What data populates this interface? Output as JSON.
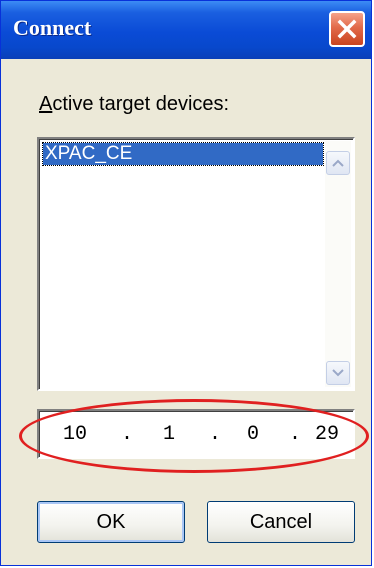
{
  "window": {
    "title": "Connect"
  },
  "devices": {
    "label_access_key": "A",
    "label_rest": "ctive target devices:",
    "items": [
      "XPAC_CE"
    ],
    "selected_index": 0
  },
  "ip_address": {
    "octets": [
      "10",
      "1",
      "0",
      "29"
    ],
    "separator": "."
  },
  "buttons": {
    "ok": "OK",
    "cancel": "Cancel"
  },
  "colors": {
    "titlebar": "#0a4bd6",
    "selection": "#316ac5",
    "highlight_ellipse": "#e02020",
    "close_button": "#e26a4a"
  },
  "icons": {
    "close": "close-icon",
    "scroll_up": "chevron-up-icon",
    "scroll_down": "chevron-down-icon"
  }
}
